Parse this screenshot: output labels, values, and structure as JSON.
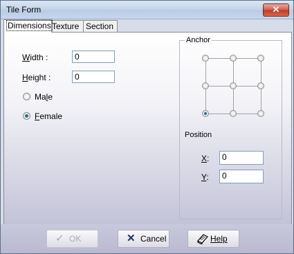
{
  "window": {
    "title": "Tile Form",
    "close_glyph": "✕"
  },
  "tabs": [
    {
      "label": "Dimensions",
      "active": true
    },
    {
      "label": "Texture",
      "active": false
    },
    {
      "label": "Section",
      "active": false
    }
  ],
  "fields": {
    "width": {
      "label_mnemonic": "W",
      "label_rest": "idth :",
      "value": "0"
    },
    "height": {
      "label_mnemonic": "H",
      "label_rest": "eight :",
      "value": "0"
    }
  },
  "gender": {
    "male": {
      "label_first": "Ma",
      "label_mnemonic": "l",
      "label_rest": "e",
      "checked": false
    },
    "female": {
      "label_mnemonic": "F",
      "label_rest": "emale",
      "checked": true
    }
  },
  "anchor": {
    "title": "Anchor",
    "selected": "bottom-left"
  },
  "position": {
    "title": "Position",
    "x": {
      "label_mnemonic": "X",
      "label_rest": ":",
      "value": "0"
    },
    "y": {
      "label_mnemonic": "Y",
      "label_rest": ":",
      "value": "0"
    }
  },
  "buttons": {
    "ok": {
      "label": "OK",
      "icon": "checkmark-icon",
      "enabled": false
    },
    "cancel": {
      "label": "Cancel",
      "icon": "x-icon",
      "enabled": true
    },
    "help": {
      "label": "Help",
      "icon": "help-book-icon",
      "enabled": true
    }
  },
  "colors": {
    "radio_selected": "#2a6a98",
    "close_button": "#c23a22",
    "input_border": "#7f9db9"
  }
}
